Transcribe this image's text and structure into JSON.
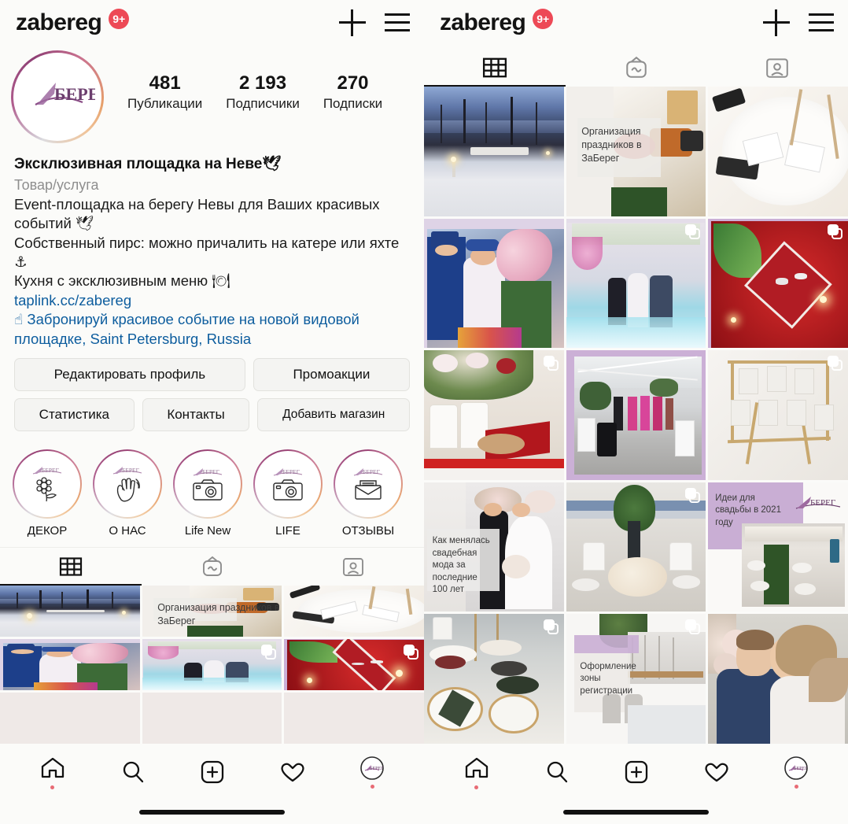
{
  "header": {
    "username": "zabereg",
    "notification_badge": "9+",
    "add_icon": "plus-icon",
    "menu_icon": "hamburger-menu-icon"
  },
  "profile": {
    "avatar_alt": "ZaБерег logo",
    "stats": [
      {
        "value": "481",
        "label": "Публикации"
      },
      {
        "value": "2 193",
        "label": "Подписчики"
      },
      {
        "value": "270",
        "label": "Подписки"
      }
    ],
    "display_name": "Эксклюзивная площадка на Неве🕊",
    "category": "Товар/услуга",
    "bio_lines": [
      "Event-площадка на берегу Невы для Ваших красивых событий 🕊",
      "Собственный пирс: можно причалить на катере или яхте ⚓",
      "Кухня с эксклюзивным меню 🍽"
    ],
    "link": "taplink.cc/zabereg",
    "address": "☝ Забронируй красивое событие на новой видовой площадке, Saint Petersburg, Russia"
  },
  "actions": {
    "row1": [
      {
        "label": "Редактировать профиль"
      },
      {
        "label": "Промоакции"
      }
    ],
    "row2": [
      {
        "label": "Статистика"
      },
      {
        "label": "Контакты"
      },
      {
        "label": "Добавить магазин"
      }
    ]
  },
  "highlights": [
    {
      "label": "ДЕКОР",
      "icon": "flower-icon"
    },
    {
      "label": "О НАС",
      "icon": "waving-hand-icon"
    },
    {
      "label": "Life New",
      "icon": "camera-icon"
    },
    {
      "label": "LIFE",
      "icon": "camera-icon"
    },
    {
      "label": "ОТЗЫВЫ",
      "icon": "envelope-icon"
    }
  ],
  "tabs": [
    {
      "name": "grid",
      "icon": "grid-icon",
      "active": true
    },
    {
      "name": "igtv",
      "icon": "igtv-icon",
      "active": false
    },
    {
      "name": "tagged",
      "icon": "tagged-user-icon",
      "active": false
    }
  ],
  "grid_posts": [
    {
      "id": 1,
      "caption": "",
      "multi": false,
      "kind": "winter-pier-night"
    },
    {
      "id": 2,
      "caption": "Организация праздников в ЗаБерег",
      "multi": false,
      "kind": "catering-banner"
    },
    {
      "id": 3,
      "caption": "",
      "multi": false,
      "kind": "table-stationery"
    },
    {
      "id": 4,
      "caption": "",
      "multi": false,
      "kind": "guests-flowers"
    },
    {
      "id": 5,
      "caption": "",
      "multi": true,
      "kind": "ceremony-smoke"
    },
    {
      "id": 6,
      "caption": "",
      "multi": true,
      "kind": "rings-red"
    },
    {
      "id": 7,
      "caption": "",
      "multi": true,
      "kind": "floral-arch-chairs"
    },
    {
      "id": 8,
      "caption": "",
      "multi": false,
      "kind": "marquee-guests"
    },
    {
      "id": 9,
      "caption": "",
      "multi": true,
      "kind": "seating-easel"
    },
    {
      "id": 10,
      "caption": "Как менялась свадебная мода за последние 100 лет",
      "multi": false,
      "kind": "bride-groom-banner"
    },
    {
      "id": 11,
      "caption": "",
      "multi": true,
      "kind": "centerpiece-greens"
    },
    {
      "id": 12,
      "caption": "Идеи для свадьбы в 2021 году",
      "multi": false,
      "kind": "ideas-2021-banner"
    },
    {
      "id": 13,
      "caption": "",
      "multi": true,
      "kind": "served-table"
    },
    {
      "id": 14,
      "caption": "Оформление зоны регистрации",
      "multi": true,
      "kind": "registration-banner"
    },
    {
      "id": 15,
      "caption": "",
      "multi": false,
      "kind": "couple-portrait"
    }
  ],
  "bottom_nav": [
    {
      "name": "home",
      "icon": "home-icon",
      "dot": true
    },
    {
      "name": "search",
      "icon": "search-icon",
      "dot": false
    },
    {
      "name": "create",
      "icon": "plus-box-icon",
      "dot": false
    },
    {
      "name": "activity",
      "icon": "heart-icon",
      "dot": false
    },
    {
      "name": "profile",
      "icon": "avatar-icon",
      "dot": true
    }
  ],
  "colors": {
    "accent_red": "#ed4956",
    "link_blue": "#0d5d9e",
    "lavender": "#c9aed4",
    "muted_gray": "#8e8e8e",
    "app_bg": "#fbfbf9"
  }
}
